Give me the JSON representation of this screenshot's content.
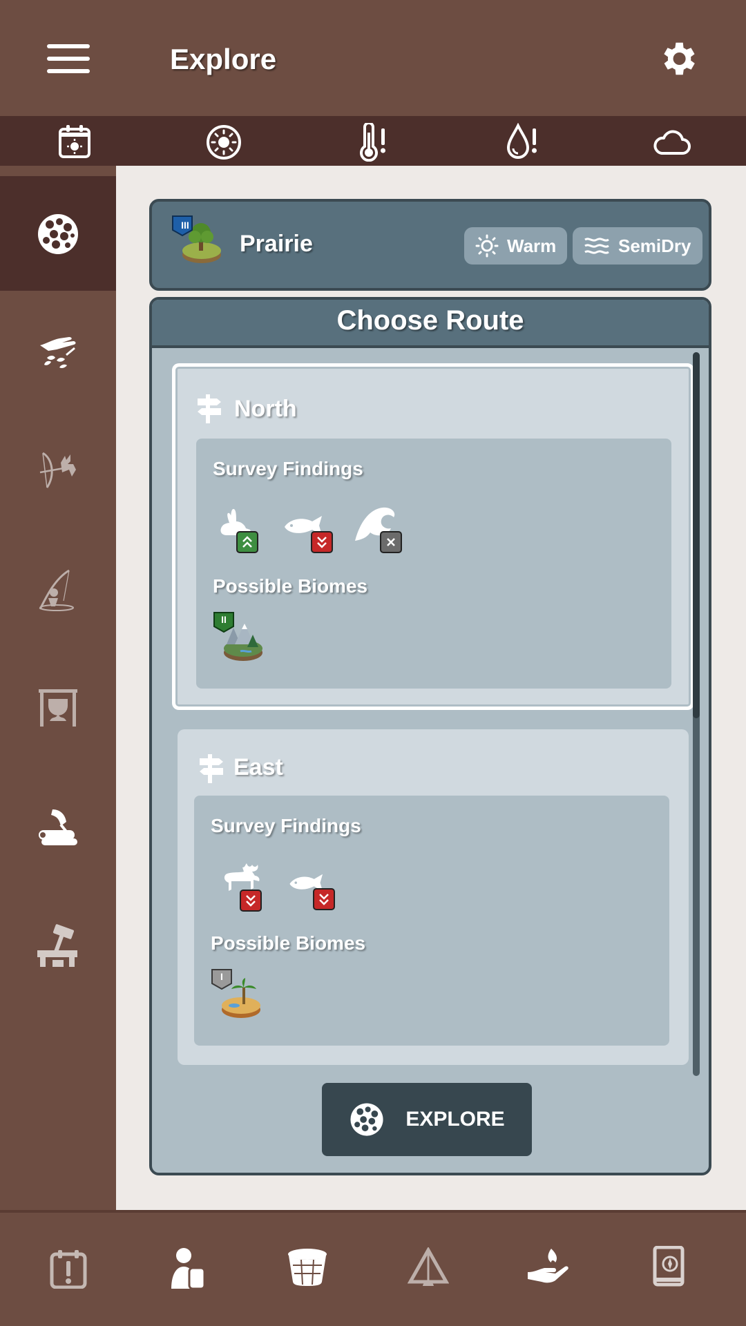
{
  "header": {
    "title": "Explore"
  },
  "biome": {
    "name": "Prairie",
    "tier": "III",
    "temperature": "Warm",
    "humidity": "SemiDry"
  },
  "route_panel": {
    "title": "Choose Route",
    "routes": [
      {
        "name": "North",
        "findings_label": "Survey Findings",
        "findings": [
          {
            "animal": "rabbit-icon",
            "trend": "up"
          },
          {
            "animal": "fish-icon",
            "trend": "down"
          },
          {
            "animal": "wave-icon",
            "trend": "none"
          }
        ],
        "biomes_label": "Possible Biomes",
        "biomes": [
          {
            "type": "forest-biome",
            "tier": "II"
          }
        ]
      },
      {
        "name": "East",
        "findings_label": "Survey Findings",
        "findings": [
          {
            "animal": "moose-icon",
            "trend": "down"
          },
          {
            "animal": "fish-icon",
            "trend": "down"
          }
        ],
        "biomes_label": "Possible Biomes",
        "biomes": [
          {
            "type": "desert-biome",
            "tier": "I"
          }
        ]
      }
    ],
    "explore_button": "EXPLORE"
  },
  "colors": {
    "brown": "#6d4d42",
    "dark_brown": "#4c2f2b",
    "slate": "#58707d",
    "panel": "#aebdc5",
    "card": "#d0d9df",
    "button": "#37474f"
  }
}
